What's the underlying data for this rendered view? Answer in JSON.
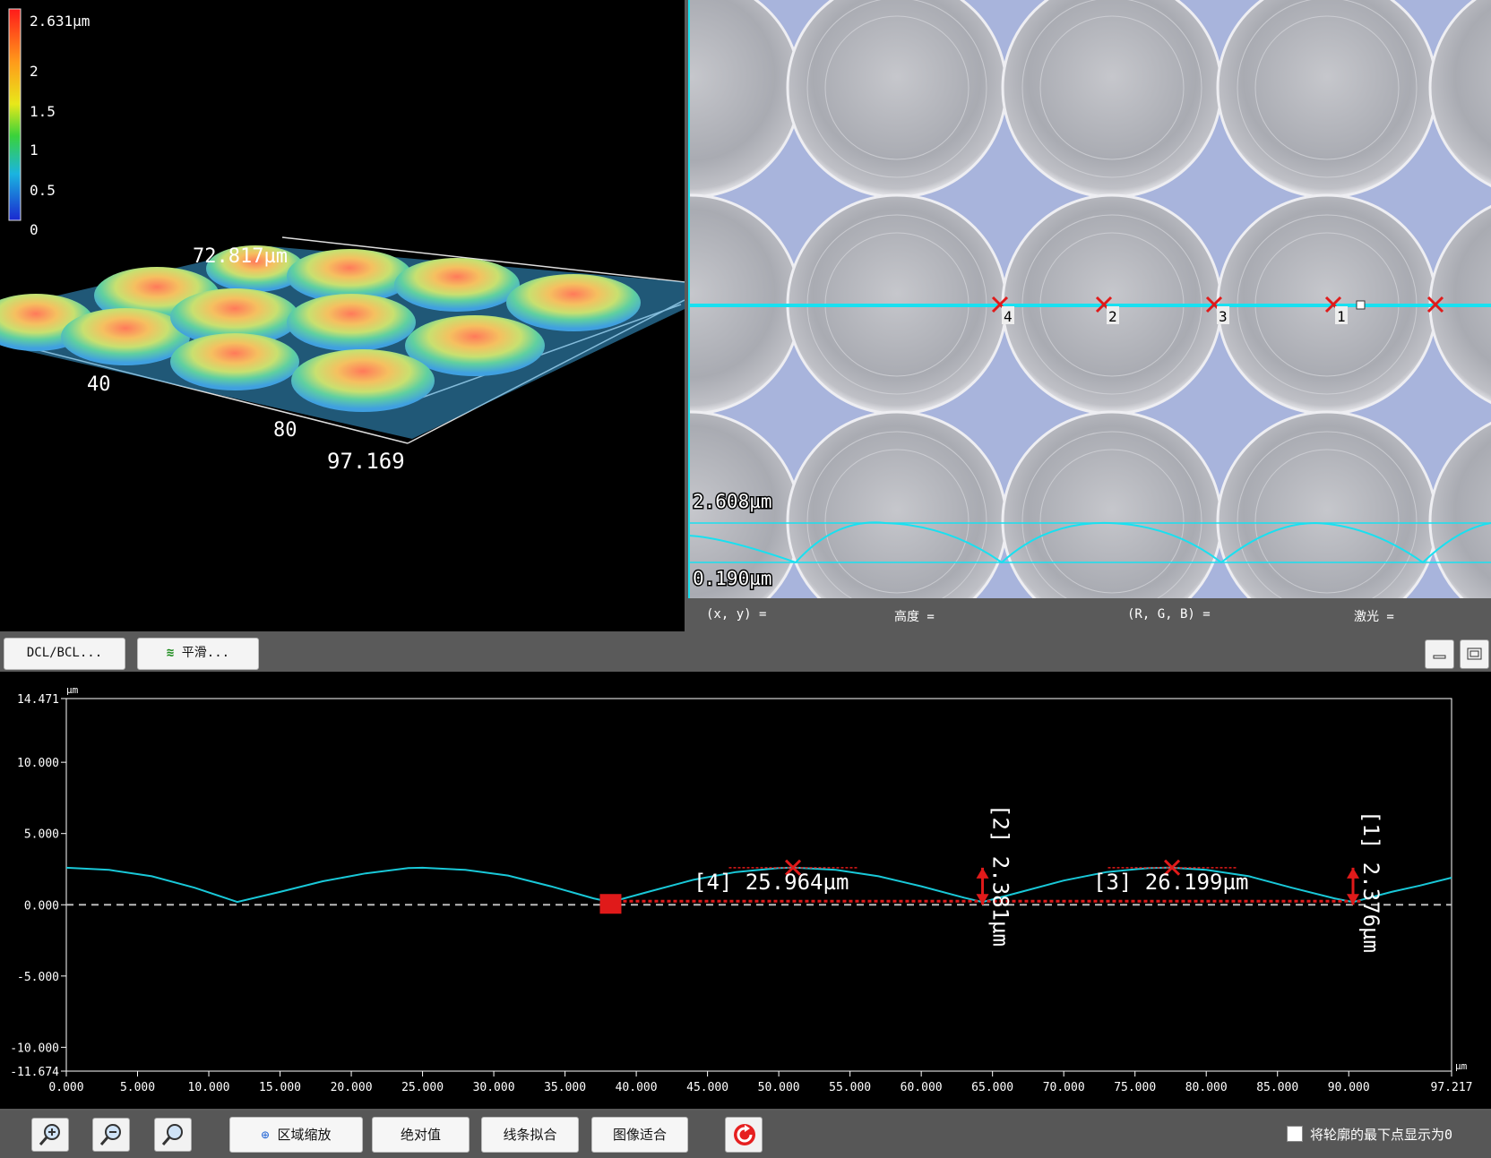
{
  "view3d": {
    "colorbar_max": "2.631µm",
    "colorbar_ticks": [
      "2",
      "1.5",
      "1",
      "0.5",
      "0"
    ],
    "axis_labels": {
      "y_top": "72.817µm",
      "x_40": "40",
      "x_80": "80",
      "x_end": "97.169"
    }
  },
  "micrograph": {
    "markers": [
      "4",
      "2",
      "3",
      "1"
    ],
    "profile_max": "2.608µm",
    "profile_min": "0.190µm"
  },
  "status": {
    "xy": "(x, y) =",
    "height": "高度 =",
    "rgb": "(R, G, B) =",
    "laser": "激光 ="
  },
  "midbar": {
    "dcl_label": "DCL/BCL...",
    "smooth_label": "平滑..."
  },
  "chart_data": {
    "type": "line",
    "ylabel": "µm",
    "xlabel": "µm",
    "xlim": [
      0,
      97.217
    ],
    "ylim": [
      -11.674,
      14.471
    ],
    "y_ticks": [
      "14.471",
      "10.000",
      "5.000",
      "0.000",
      "-5.000",
      "-10.000",
      "-11.674"
    ],
    "x_ticks": [
      "0.000",
      "5.000",
      "10.000",
      "15.000",
      "20.000",
      "25.000",
      "30.000",
      "35.000",
      "40.000",
      "45.000",
      "50.000",
      "55.000",
      "60.000",
      "65.000",
      "70.000",
      "75.000",
      "80.000",
      "85.000",
      "90.000",
      "97.217"
    ],
    "series": [
      {
        "x": [
          0,
          3,
          6,
          9,
          12,
          15,
          18,
          21,
          24,
          25,
          28,
          31,
          34,
          37,
          38.2,
          41,
          44,
          47,
          50,
          51,
          54,
          57,
          60,
          63,
          64.3,
          67,
          70,
          73,
          76,
          77.5,
          80,
          83,
          86,
          89,
          90.3,
          93,
          95,
          97.217
        ],
        "y": [
          2.6,
          2.45,
          2.0,
          1.2,
          0.2,
          0.9,
          1.65,
          2.2,
          2.58,
          2.6,
          2.45,
          2.05,
          1.3,
          0.45,
          0.19,
          0.95,
          1.75,
          2.3,
          2.58,
          2.61,
          2.45,
          2.0,
          1.3,
          0.5,
          0.19,
          0.9,
          1.7,
          2.3,
          2.58,
          2.61,
          2.45,
          2.0,
          1.2,
          0.45,
          0.19,
          0.9,
          1.35,
          1.9
        ]
      }
    ],
    "annotations": {
      "h2": "[2] 2.381µm",
      "h1": "[1] 2.376µm",
      "w4": "[4] 25.964µm",
      "w3": "[3] 26.199µm"
    },
    "marker_positions": {
      "peak_a_x": 51.0,
      "peak_b_x": 77.6,
      "valley_a_x": 38.2,
      "valley_b_x": 64.3,
      "valley_c_x": 90.3
    }
  },
  "bottombar": {
    "zoom_area": "区域缩放",
    "absolute": "绝对值",
    "line_fit": "线条拟合",
    "image_fit": "图像适合",
    "lowest_zero": "将轮廓的最下点显示为0"
  }
}
